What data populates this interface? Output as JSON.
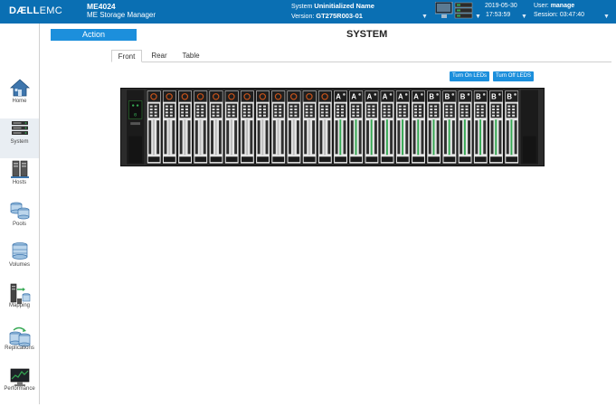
{
  "header": {
    "logo_dell": "DÆLL",
    "logo_emc": "EMC",
    "model": "ME4024",
    "product": "ME Storage Manager",
    "system_label": "System",
    "system_name": "Uninitialized Name",
    "version_label": "Version:",
    "version": "GT275R003-01",
    "date": "2019-05-30",
    "time": "17:53:59",
    "user_label": "User:",
    "user": "manage",
    "session_label": "Session:",
    "session": "03:47:40"
  },
  "sidebar": {
    "items": [
      {
        "label": "Home",
        "icon": "home-icon"
      },
      {
        "label": "System",
        "icon": "system-icon"
      },
      {
        "label": "Hosts",
        "icon": "hosts-icon"
      },
      {
        "label": "Pools",
        "icon": "pools-icon"
      },
      {
        "label": "Volumes",
        "icon": "volumes-icon"
      },
      {
        "label": "Mapping",
        "icon": "mapping-icon"
      },
      {
        "label": "Replications",
        "icon": "replications-icon"
      },
      {
        "label": "Performance",
        "icon": "performance-icon"
      }
    ],
    "active": "System"
  },
  "main": {
    "action_label": "Action",
    "title": "SYSTEM",
    "tabs": [
      "Front",
      "Rear",
      "Table"
    ],
    "active_tab": "Front",
    "turn_on_leds": "Turn On LEDs",
    "turn_off_leds": "Turn Off LEDS"
  },
  "enclosure": {
    "control_panel_id": "0",
    "slots": [
      {
        "group": ""
      },
      {
        "group": ""
      },
      {
        "group": ""
      },
      {
        "group": ""
      },
      {
        "group": ""
      },
      {
        "group": ""
      },
      {
        "group": ""
      },
      {
        "group": ""
      },
      {
        "group": ""
      },
      {
        "group": ""
      },
      {
        "group": ""
      },
      {
        "group": ""
      },
      {
        "group": "A"
      },
      {
        "group": "A"
      },
      {
        "group": "A"
      },
      {
        "group": "A"
      },
      {
        "group": "A"
      },
      {
        "group": "A"
      },
      {
        "group": "B"
      },
      {
        "group": "B"
      },
      {
        "group": "B"
      },
      {
        "group": "B"
      },
      {
        "group": "B"
      },
      {
        "group": "B"
      }
    ]
  },
  "colors": {
    "header_bg": "#0a6fb3",
    "accent": "#1c8fdc",
    "drive_led_active": "#35a853",
    "drive_led_idle": "#c9541b"
  }
}
